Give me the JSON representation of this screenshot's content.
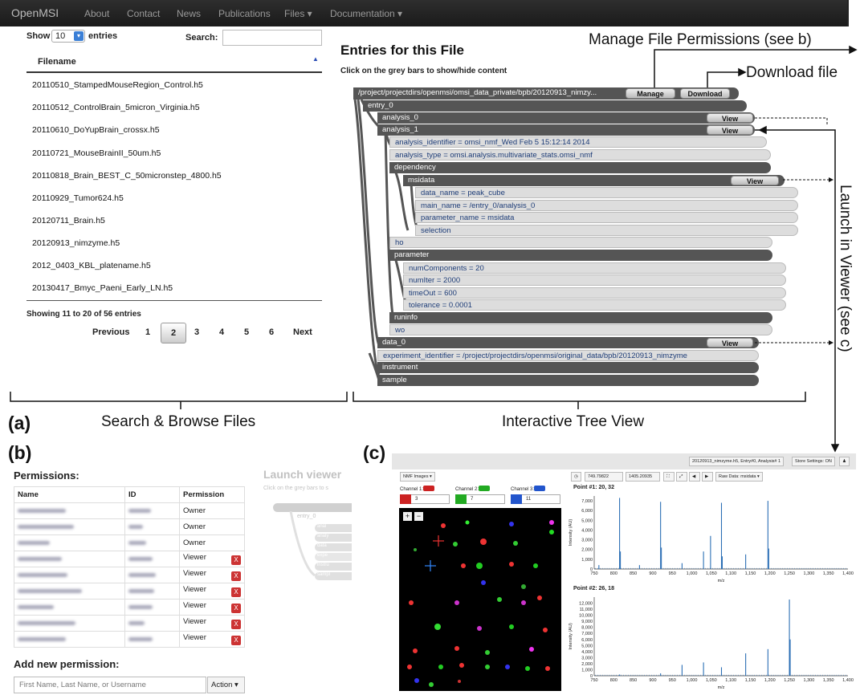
{
  "navbar": {
    "brand": "OpenMSI",
    "items": [
      "About",
      "Contact",
      "News",
      "Publications",
      "Files ▾",
      "Documentation ▾"
    ]
  },
  "browse": {
    "show_label": "Show",
    "page_size": "10",
    "entries_label": "entries",
    "search_label": "Search:",
    "search_value": "",
    "column_header": "Filename",
    "files": [
      "20110510_StampedMouseRegion_Control.h5",
      "20110512_ControlBrain_5micron_Virginia.h5",
      "20110610_DoYupBrain_crossx.h5",
      "20110721_MouseBrainII_50um.h5",
      "20110818_Brain_BEST_C_50micronstep_4800.h5",
      "20110929_Tumor624.h5",
      "20120711_Brain.h5",
      "20120913_nimzyme.h5",
      "2012_0403_KBL_platename.h5",
      "20130417_Bmyc_Paeni_Early_LN.h5"
    ],
    "info": "Showing 11 to 20 of 56 entries",
    "pagination": {
      "previous": "Previous",
      "pages": [
        "1",
        "2",
        "3",
        "4",
        "5",
        "6"
      ],
      "next": "Next",
      "current": "2"
    }
  },
  "tree": {
    "title": "Entries for this File",
    "hint": "Click on the grey bars to show/hide content",
    "root_path": "/project/projectdirs/openmsi/omsi_data_private/bpb/20120913_nimzy...",
    "manage_label": "Manage",
    "download_label": "Download",
    "view_label": "View",
    "nodes": {
      "entry_0": "entry_0",
      "analysis_0": "analysis_0",
      "analysis_1": "analysis_1",
      "analysis_identifier": "analysis_identifier = omsi_nmf_Wed Feb 5 15:12:14 2014",
      "analysis_type": "analysis_type = omsi.analysis.multivariate_stats.omsi_nmf",
      "dependency": "dependency",
      "msidata": "msidata",
      "data_name": "data_name = peak_cube",
      "main_name": "main_name = /entry_0/analysis_0",
      "parameter_name": "parameter_name = msidata",
      "selection": "selection",
      "ho": "ho",
      "parameter": "parameter",
      "numComponents": "numComponents = 20",
      "numIter": "numIter = 2000",
      "timeOut": "timeOut = 600",
      "tolerance": "tolerance = 0.0001",
      "runinfo": "runinfo",
      "wo": "wo",
      "data_0": "data_0",
      "experiment_identifier": "experiment_identifier = /project/projectdirs/openmsi/original_data/bpb/20120913_nimzyme",
      "instrument": "instrument",
      "sample": "sample"
    }
  },
  "annotations": {
    "manage_permissions": "Manage File Permissions (see b)",
    "download_file": "Download file",
    "launch_viewer": "Launch in Viewer  (see c)",
    "search_browse": "Search & Browse Files",
    "tree_view": "Interactive Tree View",
    "label_a": "(a)",
    "label_b": "(b)",
    "label_c": "(c)"
  },
  "permissions": {
    "title": "Permissions:",
    "columns": [
      "Name",
      "ID",
      "Permission"
    ],
    "rows": [
      "Owner",
      "Owner",
      "Owner",
      "Viewer",
      "Viewer",
      "Viewer",
      "Viewer",
      "Viewer",
      "Viewer"
    ],
    "remove_label": "X",
    "add_title": "Add new permission:",
    "add_placeholder": "First Name, Last Name, or Username",
    "action_label": "Action ▾",
    "faded_title": "Launch viewer",
    "faded_hint": "Click on the grey bars to s",
    "faded_nodes": [
      "entry_0",
      "anal",
      "analy",
      "data",
      "expe",
      "instru",
      "sampl"
    ]
  },
  "viewer": {
    "file_info": "20120913_nimzyme.h5,  Entry#0,  Analysis# 1",
    "store_settings": "Store Settings: ON",
    "nmf_images": "NMF Images ▾",
    "channels": [
      {
        "label": "Channel 1:",
        "value": "3",
        "color": "#cc2222"
      },
      {
        "label": "Channel 2:",
        "value": "7",
        "color": "#22aa22"
      },
      {
        "label": "Channel 3:",
        "value": "11",
        "color": "#2255cc"
      }
    ],
    "mz_low": "749.79822",
    "mz_high": "1405.20935",
    "raw_data": "Raw Data: msidata ▾",
    "point1": "Point #1: 20, 32",
    "point2": "Point #2: 26, 18",
    "zoom_in": "+",
    "zoom_out": "−"
  },
  "chart_data": [
    {
      "type": "bar",
      "title": "Point #1: 20, 32",
      "xlabel": "m/z",
      "ylabel": "Intensity (AU)",
      "xlim": [
        750,
        1400
      ],
      "ylim": [
        0,
        7500
      ],
      "xticks": [
        750,
        800,
        850,
        900,
        950,
        1000,
        1050,
        1100,
        1150,
        1200,
        1250,
        1300,
        1350,
        1400
      ],
      "yticks": [
        0,
        1000,
        2000,
        3000,
        4000,
        5000,
        6000,
        7000
      ],
      "peaks": [
        [
          762,
          400
        ],
        [
          815,
          7300
        ],
        [
          817,
          1800
        ],
        [
          866,
          400
        ],
        [
          920,
          6900
        ],
        [
          922,
          2200
        ],
        [
          975,
          600
        ],
        [
          1030,
          1800
        ],
        [
          1048,
          3400
        ],
        [
          1076,
          6800
        ],
        [
          1078,
          1300
        ],
        [
          1138,
          1500
        ],
        [
          1195,
          7000
        ],
        [
          1197,
          2100
        ]
      ]
    },
    {
      "type": "bar",
      "title": "Point #2: 26, 18",
      "xlabel": "m/z",
      "ylabel": "Intensity (AU)",
      "xlim": [
        750,
        1400
      ],
      "ylim": [
        0,
        13000
      ],
      "xticks": [
        750,
        800,
        850,
        900,
        950,
        1000,
        1050,
        1100,
        1150,
        1200,
        1250,
        1300,
        1350,
        1400
      ],
      "yticks": [
        0,
        1000,
        2000,
        3000,
        4000,
        5000,
        6000,
        7000,
        8000,
        9000,
        10000,
        11000,
        12000
      ],
      "peaks": [
        [
          815,
          200
        ],
        [
          920,
          400
        ],
        [
          975,
          1800
        ],
        [
          1030,
          2200
        ],
        [
          1076,
          1400
        ],
        [
          1138,
          3700
        ],
        [
          1195,
          4400
        ],
        [
          1250,
          12600
        ],
        [
          1252,
          6000
        ]
      ]
    }
  ]
}
